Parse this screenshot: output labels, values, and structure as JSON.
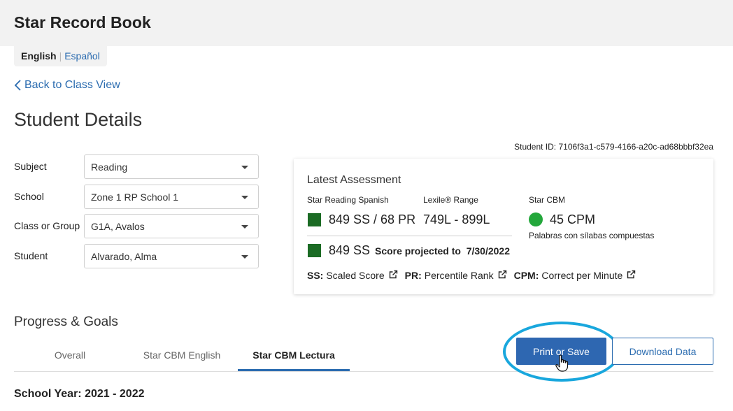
{
  "app": {
    "title": "Star Record Book"
  },
  "language": {
    "current": "English",
    "separator": "|",
    "alternate": "Español"
  },
  "nav": {
    "back_label": "Back to Class View"
  },
  "page": {
    "title": "Student Details",
    "student_id": "Student ID: 7106f3a1-c579-4166-a20c-ad68bbbf32ea"
  },
  "filters": [
    {
      "label": "Subject",
      "value": "Reading"
    },
    {
      "label": "School",
      "value": "Zone 1 RP School 1"
    },
    {
      "label": "Class or Group",
      "value": "G1A, Avalos"
    },
    {
      "label": "Student",
      "value": "Alvarado, Alma"
    }
  ],
  "assessment": {
    "title": "Latest Assessment",
    "star_reading": {
      "label": "Star Reading Spanish",
      "value": "849 SS / 68 PR",
      "color": "#1b6b24"
    },
    "lexile": {
      "label": "Lexile® Range",
      "value": "749L - 899L"
    },
    "projected": {
      "value": "849 SS",
      "label": "Score projected to",
      "date": "7/30/2022"
    },
    "cbm": {
      "label": "Star CBM",
      "value": "45 CPM",
      "sub": "Palabras con sílabas compuestas",
      "color": "#23a73b"
    },
    "legend": [
      {
        "abbr": "SS:",
        "text": "Scaled Score"
      },
      {
        "abbr": "PR:",
        "text": "Percentile Rank"
      },
      {
        "abbr": "CPM:",
        "text": "Correct per Minute"
      }
    ]
  },
  "progress": {
    "title": "Progress & Goals",
    "tabs": [
      "Overall",
      "Star CBM English",
      "Star CBM Lectura"
    ],
    "active_tab": "Star CBM Lectura",
    "print_label": "Print or Save",
    "download_label": "Download Data",
    "school_year": "School Year: 2021 - 2022"
  },
  "colors": {
    "accent": "#2e67b1",
    "highlight": "#19a7dd",
    "link": "#2b6cb0"
  }
}
